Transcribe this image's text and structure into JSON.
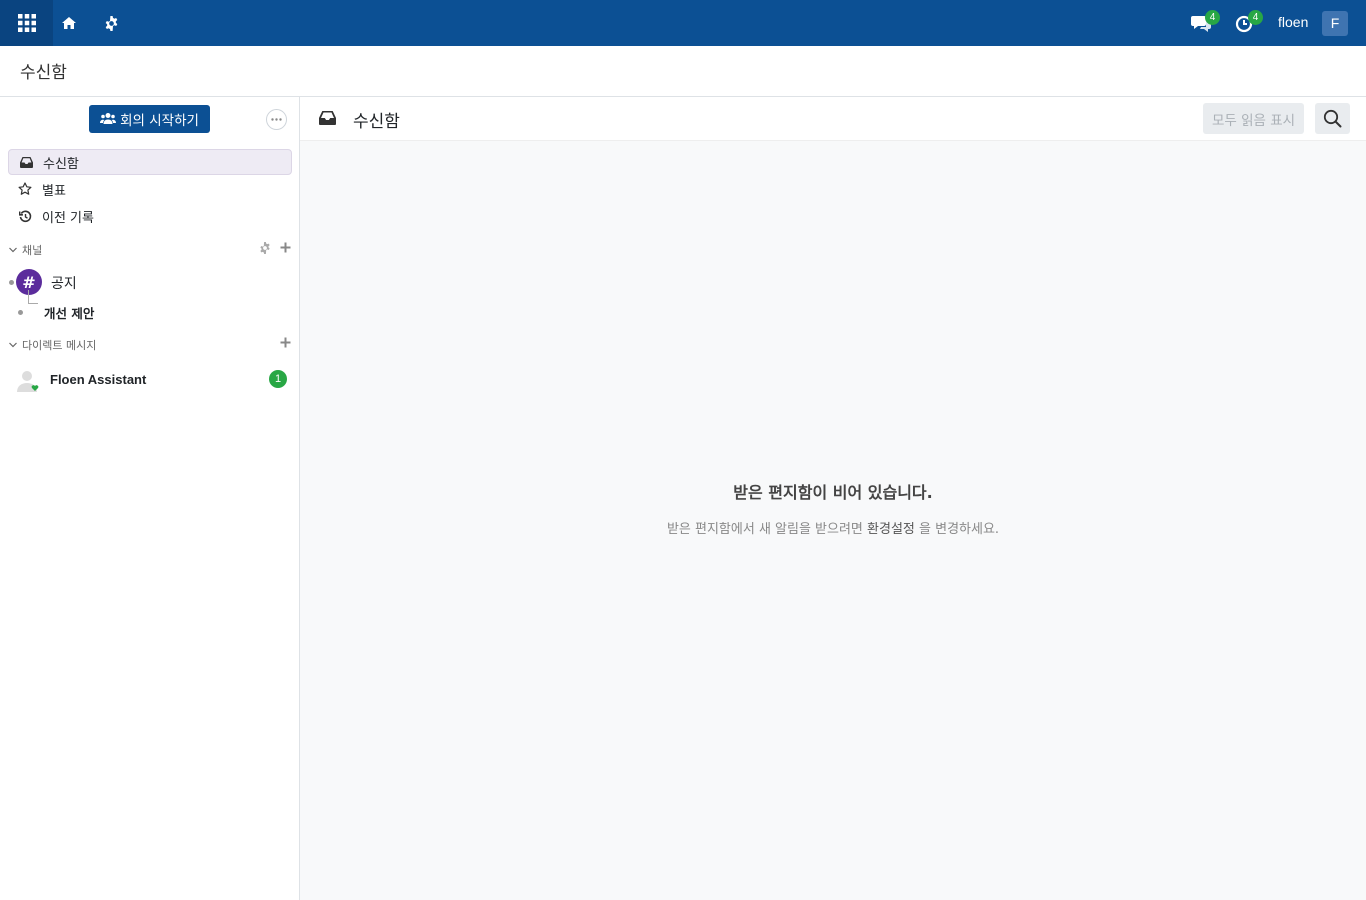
{
  "topbar": {
    "notifications": {
      "messages_count": "4",
      "activities_count": "4"
    },
    "username": "floen",
    "avatar_initial": "F"
  },
  "breadcrumb": "수신함",
  "sidebar": {
    "start_meeting_label": "회의 시작하기",
    "mailboxes": [
      {
        "label": "수신함",
        "icon": "inbox-icon"
      },
      {
        "label": "별표",
        "icon": "star-icon"
      },
      {
        "label": "이전 기록",
        "icon": "history-icon"
      }
    ],
    "channels_header": "채널",
    "channels": [
      {
        "name": "공지",
        "sub_channels": [
          "개선 제안"
        ]
      }
    ],
    "dm_header": "다이렉트 메시지",
    "direct_messages": [
      {
        "name": "Floen Assistant",
        "unread": "1",
        "status": "online"
      }
    ]
  },
  "main": {
    "title": "수신함",
    "mark_all_read": "모두 읽음 표시",
    "empty_title": "받은 편지함이 비어 있습니다.",
    "empty_sub_before": "받은 편지함에서 새 알림을 받으려면",
    "empty_sub_link": "환경설정",
    "empty_sub_after": "을 변경하세요."
  },
  "colors": {
    "navbar": "#0c5094",
    "accent_green": "#28a745",
    "channel_avatar": "#5b2c9c"
  }
}
